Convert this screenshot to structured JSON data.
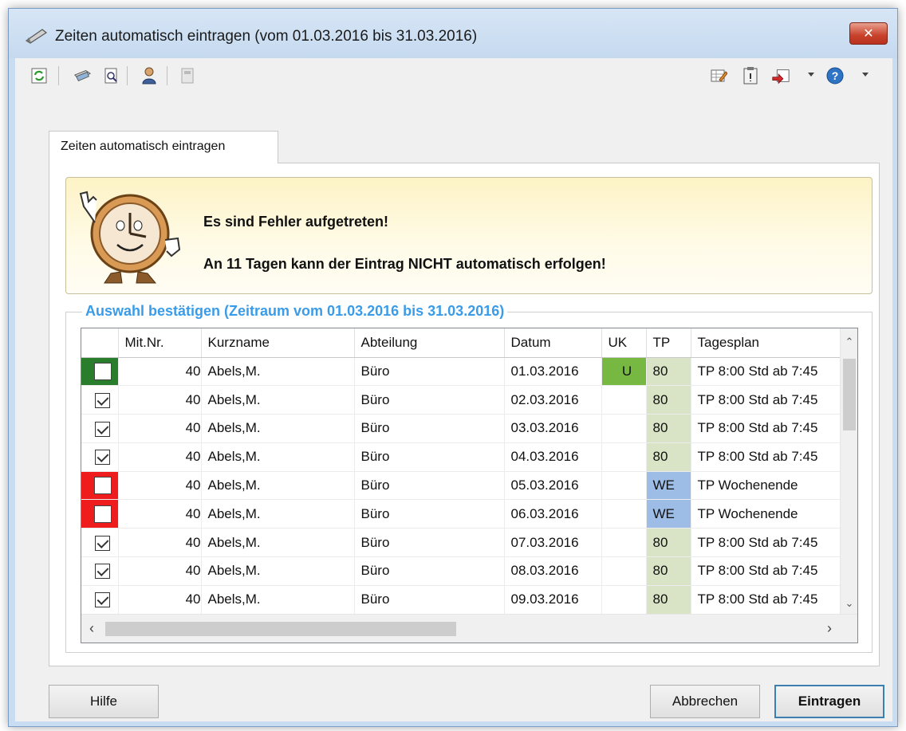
{
  "window": {
    "title": "Zeiten automatisch eintragen (vom 01.03.2016 bis 31.03.2016)",
    "close_label": "✕"
  },
  "toolbar": {
    "icons": [
      "refresh-icon",
      "print-icon",
      "print-preview-icon",
      "user-icon",
      "disabled-icon",
      "edit-table-icon",
      "clipboard-icon",
      "exit-icon",
      "help-icon"
    ]
  },
  "tab": {
    "label": "Zeiten automatisch eintragen"
  },
  "alert": {
    "line1": "Es sind Fehler aufgetreten!",
    "line2": "An 11 Tagen kann der Eintrag NICHT automatisch erfolgen!"
  },
  "selection": {
    "title": "Auswahl bestätigen (Zeitraum vom 01.03.2016 bis 31.03.2016)",
    "columns": [
      "",
      "Mit.Nr.",
      "Kurzname",
      "Abteilung",
      "Datum",
      "UK",
      "TP",
      "Tagesplan"
    ],
    "rows": [
      {
        "status": "green-unchecked",
        "nr": "40",
        "name": "Abels,M.",
        "dept": "Büro",
        "date": "01.03.2016",
        "uk": "U",
        "tp": "80",
        "plan": "TP 8:00 Std ab 7:45"
      },
      {
        "status": "checked",
        "nr": "40",
        "name": "Abels,M.",
        "dept": "Büro",
        "date": "02.03.2016",
        "uk": "",
        "tp": "80",
        "plan": "TP 8:00 Std ab 7:45"
      },
      {
        "status": "checked",
        "nr": "40",
        "name": "Abels,M.",
        "dept": "Büro",
        "date": "03.03.2016",
        "uk": "",
        "tp": "80",
        "plan": "TP 8:00 Std ab 7:45"
      },
      {
        "status": "checked",
        "nr": "40",
        "name": "Abels,M.",
        "dept": "Büro",
        "date": "04.03.2016",
        "uk": "",
        "tp": "80",
        "plan": "TP 8:00 Std ab 7:45"
      },
      {
        "status": "red-unchecked",
        "nr": "40",
        "name": "Abels,M.",
        "dept": "Büro",
        "date": "05.03.2016",
        "uk": "",
        "tp": "WE",
        "plan": "TP Wochenende"
      },
      {
        "status": "red-unchecked",
        "nr": "40",
        "name": "Abels,M.",
        "dept": "Büro",
        "date": "06.03.2016",
        "uk": "",
        "tp": "WE",
        "plan": "TP Wochenende"
      },
      {
        "status": "checked",
        "nr": "40",
        "name": "Abels,M.",
        "dept": "Büro",
        "date": "07.03.2016",
        "uk": "",
        "tp": "80",
        "plan": "TP 8:00 Std ab 7:45"
      },
      {
        "status": "checked",
        "nr": "40",
        "name": "Abels,M.",
        "dept": "Büro",
        "date": "08.03.2016",
        "uk": "",
        "tp": "80",
        "plan": "TP 8:00 Std ab 7:45"
      },
      {
        "status": "checked",
        "nr": "40",
        "name": "Abels,M.",
        "dept": "Büro",
        "date": "09.03.2016",
        "uk": "",
        "tp": "80",
        "plan": "TP 8:00 Std ab 7:45"
      }
    ]
  },
  "buttons": {
    "help": "Hilfe",
    "cancel": "Abbrechen",
    "submit": "Eintragen"
  },
  "colors": {
    "group_title": "#3a9ce8",
    "uk_u": "#76b841",
    "tp_80": "#d8e4c5",
    "tp_we": "#9dbde6",
    "error_red": "#ee1c1c",
    "focus_green": "#2a7d2a"
  }
}
